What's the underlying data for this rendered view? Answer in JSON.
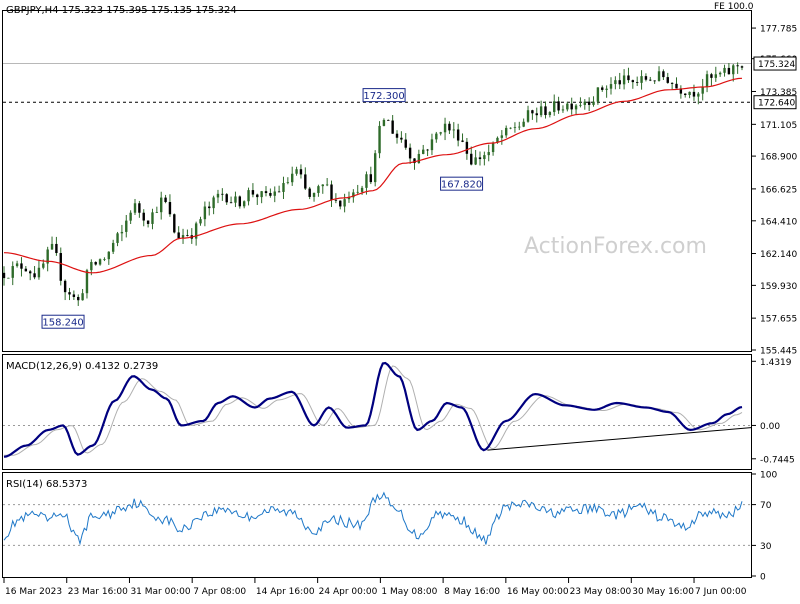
{
  "header": {
    "symbol_line": "GBPJPY,H4  175.323 175.395 175.135 175.324",
    "fe_label": "FE 100.0"
  },
  "watermark": "ActionForex.com",
  "colors": {
    "candle": "#2e6b2a",
    "ma": "#dd1111",
    "macd": "#00007f",
    "signal": "#b0b0b0",
    "rsi": "#1f78c8",
    "axis": "#000000",
    "label_box": "#1a2a8a"
  },
  "chart_data": [
    {
      "type": "candlestick",
      "name": "price",
      "ylim": [
        155.445,
        178.9
      ],
      "y_ticks": [
        "177.785",
        "175.660",
        "173.385",
        "171.105",
        "168.900",
        "166.625",
        "164.410",
        "162.140",
        "159.930",
        "157.655",
        "155.445"
      ],
      "current_price": "175.324",
      "level_line": "172.640",
      "annotations": [
        {
          "text": "172.300",
          "date_index": 0.515,
          "value": 172.3,
          "side": "above"
        },
        {
          "text": "167.820",
          "date_index": 0.62,
          "value": 167.82,
          "side": "below"
        },
        {
          "text": "158.240",
          "date_index": 0.08,
          "value": 158.24,
          "side": "below"
        }
      ],
      "anchors": [
        {
          "t": 0.0,
          "v": 160.8
        },
        {
          "t": 0.025,
          "v": 161.3
        },
        {
          "t": 0.045,
          "v": 160.7
        },
        {
          "t": 0.065,
          "v": 162.4
        },
        {
          "t": 0.085,
          "v": 159.6
        },
        {
          "t": 0.1,
          "v": 158.8
        },
        {
          "t": 0.115,
          "v": 161.1
        },
        {
          "t": 0.135,
          "v": 161.8
        },
        {
          "t": 0.155,
          "v": 163.2
        },
        {
          "t": 0.175,
          "v": 165.4
        },
        {
          "t": 0.195,
          "v": 164.6
        },
        {
          "t": 0.215,
          "v": 165.8
        },
        {
          "t": 0.235,
          "v": 163.4
        },
        {
          "t": 0.255,
          "v": 163.6
        },
        {
          "t": 0.275,
          "v": 165.2
        },
        {
          "t": 0.295,
          "v": 166.3
        },
        {
          "t": 0.315,
          "v": 165.7
        },
        {
          "t": 0.335,
          "v": 166.4
        },
        {
          "t": 0.355,
          "v": 166.0
        },
        {
          "t": 0.375,
          "v": 166.6
        },
        {
          "t": 0.395,
          "v": 167.8
        },
        {
          "t": 0.415,
          "v": 166.0
        },
        {
          "t": 0.435,
          "v": 166.8
        },
        {
          "t": 0.455,
          "v": 165.6
        },
        {
          "t": 0.475,
          "v": 166.7
        },
        {
          "t": 0.495,
          "v": 167.4
        },
        {
          "t": 0.515,
          "v": 171.5
        },
        {
          "t": 0.535,
          "v": 170.2
        },
        {
          "t": 0.555,
          "v": 168.8
        },
        {
          "t": 0.575,
          "v": 169.6
        },
        {
          "t": 0.595,
          "v": 171.0
        },
        {
          "t": 0.615,
          "v": 170.4
        },
        {
          "t": 0.635,
          "v": 168.6
        },
        {
          "t": 0.655,
          "v": 169.1
        },
        {
          "t": 0.675,
          "v": 170.3
        },
        {
          "t": 0.695,
          "v": 171.0
        },
        {
          "t": 0.715,
          "v": 171.8
        },
        {
          "t": 0.735,
          "v": 172.1
        },
        {
          "t": 0.755,
          "v": 172.4
        },
        {
          "t": 0.775,
          "v": 172.6
        },
        {
          "t": 0.795,
          "v": 172.9
        },
        {
          "t": 0.815,
          "v": 173.7
        },
        {
          "t": 0.835,
          "v": 174.1
        },
        {
          "t": 0.855,
          "v": 174.0
        },
        {
          "t": 0.875,
          "v": 174.3
        },
        {
          "t": 0.895,
          "v": 174.4
        },
        {
          "t": 0.915,
          "v": 173.6
        },
        {
          "t": 0.935,
          "v": 173.4
        },
        {
          "t": 0.955,
          "v": 174.2
        },
        {
          "t": 0.975,
          "v": 174.6
        },
        {
          "t": 1.0,
          "v": 175.3
        }
      ],
      "ma_anchors": [
        {
          "t": 0.0,
          "v": 162.2
        },
        {
          "t": 0.06,
          "v": 161.6
        },
        {
          "t": 0.12,
          "v": 160.8
        },
        {
          "t": 0.2,
          "v": 162.0
        },
        {
          "t": 0.24,
          "v": 163.2
        },
        {
          "t": 0.32,
          "v": 164.2
        },
        {
          "t": 0.4,
          "v": 165.2
        },
        {
          "t": 0.46,
          "v": 166.0
        },
        {
          "t": 0.5,
          "v": 166.5
        },
        {
          "t": 0.54,
          "v": 168.4
        },
        {
          "t": 0.6,
          "v": 169.0
        },
        {
          "t": 0.66,
          "v": 169.8
        },
        {
          "t": 0.72,
          "v": 170.8
        },
        {
          "t": 0.78,
          "v": 171.8
        },
        {
          "t": 0.84,
          "v": 172.7
        },
        {
          "t": 0.9,
          "v": 173.5
        },
        {
          "t": 0.95,
          "v": 173.7
        },
        {
          "t": 1.0,
          "v": 174.3
        }
      ]
    },
    {
      "type": "line",
      "name": "macd",
      "label": "MACD(12,26,9) 0.4132 0.2739",
      "ylim": [
        -0.95,
        1.55
      ],
      "y_ticks": [
        {
          "text": "1.4319",
          "value": 1.4319
        },
        {
          "text": "0.00",
          "value": 0.0
        },
        {
          "text": "-0.7445",
          "value": -0.7445
        }
      ],
      "zero_label": "0.00",
      "trendline": [
        {
          "t": 0.655,
          "v": -0.55
        },
        {
          "t": 1.0,
          "v": -0.05
        }
      ],
      "anchors": [
        {
          "t": 0.0,
          "v": -0.7
        },
        {
          "t": 0.03,
          "v": -0.45
        },
        {
          "t": 0.06,
          "v": -0.1
        },
        {
          "t": 0.08,
          "v": 0.0
        },
        {
          "t": 0.1,
          "v": -0.65
        },
        {
          "t": 0.12,
          "v": -0.45
        },
        {
          "t": 0.15,
          "v": 0.55
        },
        {
          "t": 0.175,
          "v": 1.1
        },
        {
          "t": 0.2,
          "v": 0.8
        },
        {
          "t": 0.22,
          "v": 0.6
        },
        {
          "t": 0.24,
          "v": 0.0
        },
        {
          "t": 0.27,
          "v": 0.1
        },
        {
          "t": 0.29,
          "v": 0.5
        },
        {
          "t": 0.31,
          "v": 0.65
        },
        {
          "t": 0.34,
          "v": 0.4
        },
        {
          "t": 0.36,
          "v": 0.6
        },
        {
          "t": 0.39,
          "v": 0.75
        },
        {
          "t": 0.42,
          "v": 0.0
        },
        {
          "t": 0.44,
          "v": 0.4
        },
        {
          "t": 0.465,
          "v": -0.05
        },
        {
          "t": 0.49,
          "v": 0.0
        },
        {
          "t": 0.515,
          "v": 1.4
        },
        {
          "t": 0.535,
          "v": 1.1
        },
        {
          "t": 0.56,
          "v": -0.1
        },
        {
          "t": 0.58,
          "v": 0.1
        },
        {
          "t": 0.6,
          "v": 0.5
        },
        {
          "t": 0.62,
          "v": 0.4
        },
        {
          "t": 0.65,
          "v": -0.55
        },
        {
          "t": 0.68,
          "v": 0.1
        },
        {
          "t": 0.72,
          "v": 0.7
        },
        {
          "t": 0.76,
          "v": 0.45
        },
        {
          "t": 0.8,
          "v": 0.35
        },
        {
          "t": 0.83,
          "v": 0.5
        },
        {
          "t": 0.87,
          "v": 0.4
        },
        {
          "t": 0.9,
          "v": 0.3
        },
        {
          "t": 0.93,
          "v": -0.1
        },
        {
          "t": 0.96,
          "v": 0.05
        },
        {
          "t": 0.98,
          "v": 0.25
        },
        {
          "t": 1.0,
          "v": 0.41
        }
      ]
    },
    {
      "type": "line",
      "name": "rsi",
      "label": "RSI(14) 68.5373",
      "ylim": [
        0,
        100
      ],
      "y_ticks": [
        {
          "text": "100",
          "value": 100
        },
        {
          "text": "70",
          "value": 70
        },
        {
          "text": "30",
          "value": 30
        },
        {
          "text": "0",
          "value": 0
        }
      ],
      "levels": [
        70,
        30
      ],
      "anchors": [
        {
          "t": 0.0,
          "v": 40
        },
        {
          "t": 0.02,
          "v": 55
        },
        {
          "t": 0.04,
          "v": 60
        },
        {
          "t": 0.06,
          "v": 55
        },
        {
          "t": 0.08,
          "v": 62
        },
        {
          "t": 0.1,
          "v": 35
        },
        {
          "t": 0.12,
          "v": 58
        },
        {
          "t": 0.14,
          "v": 60
        },
        {
          "t": 0.16,
          "v": 68
        },
        {
          "t": 0.18,
          "v": 72
        },
        {
          "t": 0.2,
          "v": 60
        },
        {
          "t": 0.22,
          "v": 55
        },
        {
          "t": 0.24,
          "v": 45
        },
        {
          "t": 0.27,
          "v": 60
        },
        {
          "t": 0.3,
          "v": 66
        },
        {
          "t": 0.33,
          "v": 58
        },
        {
          "t": 0.36,
          "v": 64
        },
        {
          "t": 0.39,
          "v": 62
        },
        {
          "t": 0.42,
          "v": 45
        },
        {
          "t": 0.45,
          "v": 55
        },
        {
          "t": 0.48,
          "v": 50
        },
        {
          "t": 0.51,
          "v": 80
        },
        {
          "t": 0.53,
          "v": 65
        },
        {
          "t": 0.56,
          "v": 40
        },
        {
          "t": 0.59,
          "v": 62
        },
        {
          "t": 0.62,
          "v": 55
        },
        {
          "t": 0.65,
          "v": 35
        },
        {
          "t": 0.68,
          "v": 68
        },
        {
          "t": 0.71,
          "v": 70
        },
        {
          "t": 0.74,
          "v": 62
        },
        {
          "t": 0.77,
          "v": 64
        },
        {
          "t": 0.8,
          "v": 66
        },
        {
          "t": 0.83,
          "v": 60
        },
        {
          "t": 0.86,
          "v": 68
        },
        {
          "t": 0.89,
          "v": 58
        },
        {
          "t": 0.92,
          "v": 48
        },
        {
          "t": 0.95,
          "v": 62
        },
        {
          "t": 0.98,
          "v": 60
        },
        {
          "t": 1.0,
          "v": 68.5
        }
      ]
    }
  ],
  "x_labels": [
    {
      "text": "16 Mar 2023",
      "t": 0.0
    },
    {
      "text": "23 Mar 16:00",
      "t": 0.085
    },
    {
      "text": "31 Mar 00:00",
      "t": 0.17
    },
    {
      "text": "7 Apr 08:00",
      "t": 0.255
    },
    {
      "text": "14 Apr 16:00",
      "t": 0.34
    },
    {
      "text": "24 Apr 00:00",
      "t": 0.425
    },
    {
      "text": "1 May 08:00",
      "t": 0.51
    },
    {
      "text": "8 May 16:00",
      "t": 0.595
    },
    {
      "text": "16 May 00:00",
      "t": 0.68
    },
    {
      "text": "23 May 08:00",
      "t": 0.765
    },
    {
      "text": "30 May 16:00",
      "t": 0.85
    },
    {
      "text": "7 Jun 00:00",
      "t": 0.935
    }
  ]
}
